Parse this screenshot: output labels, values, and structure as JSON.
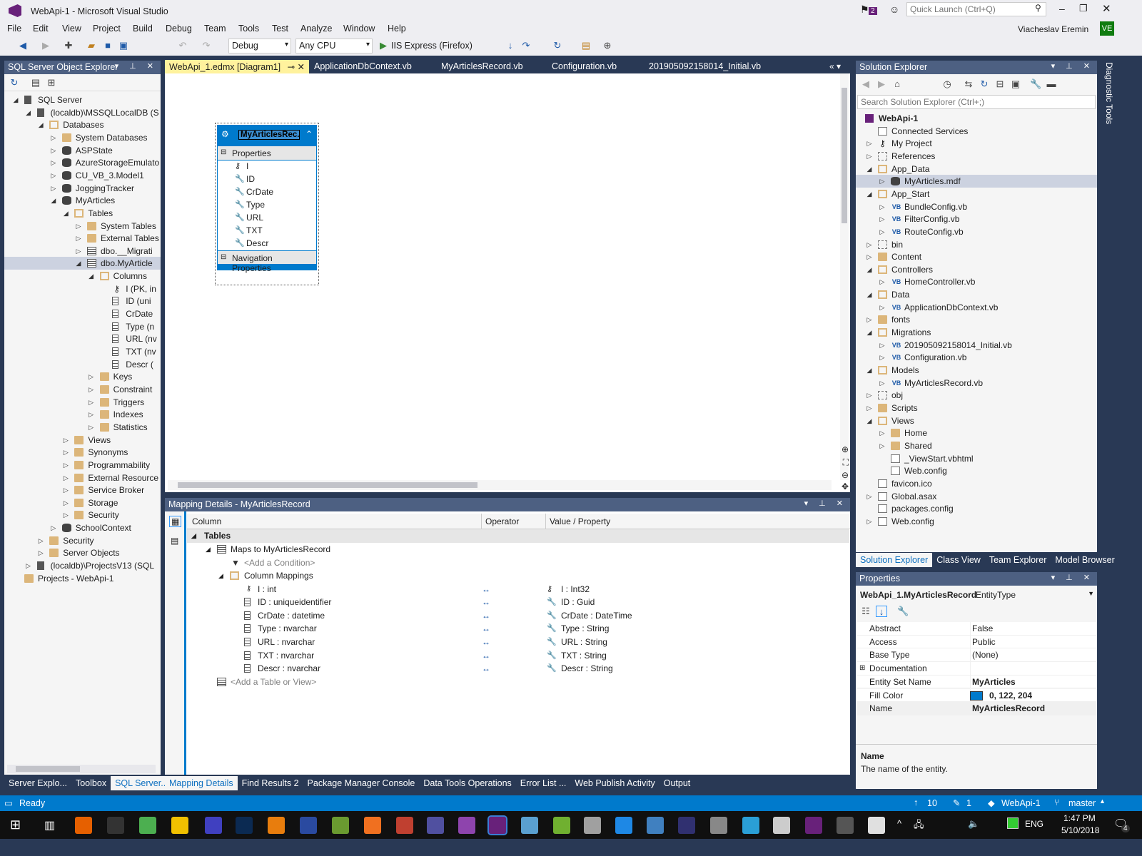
{
  "window": {
    "title": "WebApi-1 - Microsoft Visual Studio",
    "notifications": "2",
    "quick_launch_placeholder": "Quick Launch (Ctrl+Q)",
    "user": "Viacheslav Eremin",
    "user_initials": "VE"
  },
  "menu": [
    "File",
    "Edit",
    "View",
    "Project",
    "Build",
    "Debug",
    "Team",
    "Tools",
    "Test",
    "Analyze",
    "Window",
    "Help"
  ],
  "toolbar": {
    "config": "Debug",
    "platform": "Any CPU",
    "run_label": "IIS Express (Firefox)"
  },
  "sql_explorer": {
    "title": "SQL Server Object Explorer",
    "items": [
      {
        "label": "SQL Server",
        "depth": 0,
        "exp": "open",
        "icon": "server"
      },
      {
        "label": "(localdb)\\MSSQLLocalDB (S",
        "depth": 1,
        "exp": "open",
        "icon": "server"
      },
      {
        "label": "Databases",
        "depth": 2,
        "exp": "open",
        "icon": "folder-open"
      },
      {
        "label": "System Databases",
        "depth": 3,
        "exp": "closed",
        "icon": "folder"
      },
      {
        "label": "ASPState",
        "depth": 3,
        "exp": "closed",
        "icon": "db"
      },
      {
        "label": "AzureStorageEmulato",
        "depth": 3,
        "exp": "closed",
        "icon": "db"
      },
      {
        "label": "CU_VB_3.Model1",
        "depth": 3,
        "exp": "closed",
        "icon": "db"
      },
      {
        "label": "JoggingTracker",
        "depth": 3,
        "exp": "closed",
        "icon": "db"
      },
      {
        "label": "MyArticles",
        "depth": 3,
        "exp": "open",
        "icon": "db"
      },
      {
        "label": "Tables",
        "depth": 4,
        "exp": "open",
        "icon": "folder-open"
      },
      {
        "label": "System Tables",
        "depth": 5,
        "exp": "closed",
        "icon": "folder"
      },
      {
        "label": "External Tables",
        "depth": 5,
        "exp": "closed",
        "icon": "folder"
      },
      {
        "label": "dbo.__Migrati",
        "depth": 5,
        "exp": "closed",
        "icon": "table"
      },
      {
        "label": "dbo.MyArticle",
        "depth": 5,
        "exp": "open",
        "icon": "table",
        "selected": true
      },
      {
        "label": "Columns",
        "depth": 6,
        "exp": "open",
        "icon": "folder-open"
      },
      {
        "label": "I (PK, in",
        "depth": 7,
        "exp": "",
        "icon": "key"
      },
      {
        "label": "ID (uni",
        "depth": 7,
        "exp": "",
        "icon": "col"
      },
      {
        "label": "CrDate",
        "depth": 7,
        "exp": "",
        "icon": "col"
      },
      {
        "label": "Type (n",
        "depth": 7,
        "exp": "",
        "icon": "col"
      },
      {
        "label": "URL (nv",
        "depth": 7,
        "exp": "",
        "icon": "col"
      },
      {
        "label": "TXT (nv",
        "depth": 7,
        "exp": "",
        "icon": "col"
      },
      {
        "label": "Descr (",
        "depth": 7,
        "exp": "",
        "icon": "col"
      },
      {
        "label": "Keys",
        "depth": 6,
        "exp": "closed",
        "icon": "folder"
      },
      {
        "label": "Constraint",
        "depth": 6,
        "exp": "closed",
        "icon": "folder"
      },
      {
        "label": "Triggers",
        "depth": 6,
        "exp": "closed",
        "icon": "folder"
      },
      {
        "label": "Indexes",
        "depth": 6,
        "exp": "closed",
        "icon": "folder"
      },
      {
        "label": "Statistics",
        "depth": 6,
        "exp": "closed",
        "icon": "folder"
      },
      {
        "label": "Views",
        "depth": 4,
        "exp": "closed",
        "icon": "folder"
      },
      {
        "label": "Synonyms",
        "depth": 4,
        "exp": "closed",
        "icon": "folder"
      },
      {
        "label": "Programmability",
        "depth": 4,
        "exp": "closed",
        "icon": "folder"
      },
      {
        "label": "External Resource",
        "depth": 4,
        "exp": "closed",
        "icon": "folder"
      },
      {
        "label": "Service Broker",
        "depth": 4,
        "exp": "closed",
        "icon": "folder"
      },
      {
        "label": "Storage",
        "depth": 4,
        "exp": "closed",
        "icon": "folder"
      },
      {
        "label": "Security",
        "depth": 4,
        "exp": "closed",
        "icon": "folder"
      },
      {
        "label": "SchoolContext",
        "depth": 3,
        "exp": "closed",
        "icon": "db"
      },
      {
        "label": "Security",
        "depth": 2,
        "exp": "closed",
        "icon": "folder"
      },
      {
        "label": "Server Objects",
        "depth": 2,
        "exp": "closed",
        "icon": "folder"
      },
      {
        "label": "(localdb)\\ProjectsV13 (SQL",
        "depth": 1,
        "exp": "closed",
        "icon": "server"
      },
      {
        "label": "Projects - WebApi-1",
        "depth": 0,
        "exp": "",
        "icon": "folder"
      }
    ],
    "tabs": [
      "Server Explo...",
      "Toolbox",
      "SQL Server..."
    ]
  },
  "editor_tabs": [
    "WebApi_1.edmx [Diagram1]",
    "ApplicationDbContext.vb",
    "MyArticlesRecord.vb",
    "Configuration.vb",
    "201905092158014_Initial.vb"
  ],
  "entity": {
    "name": "MyArticlesRec...",
    "properties_label": "Properties",
    "properties": [
      "I",
      "ID",
      "CrDate",
      "Type",
      "URL",
      "TXT",
      "Descr"
    ],
    "nav_label": "Navigation Properties",
    "fill": "#007acc"
  },
  "mapping": {
    "title": "Mapping Details - MyArticlesRecord",
    "headers": [
      "Column",
      "Operator",
      "Value / Property"
    ],
    "tables": "Tables",
    "maps_to": "Maps to MyArticlesRecord",
    "add_condition": "<Add a Condition>",
    "column_mappings": "Column Mappings",
    "rows": [
      {
        "col": "I : int",
        "op": "↔",
        "val": "I : Int32"
      },
      {
        "col": "ID : uniqueidentifier",
        "op": "↔",
        "val": "ID : Guid"
      },
      {
        "col": "CrDate : datetime",
        "op": "↔",
        "val": "CrDate : DateTime"
      },
      {
        "col": "Type : nvarchar",
        "op": "↔",
        "val": "Type : String"
      },
      {
        "col": "URL : nvarchar",
        "op": "↔",
        "val": "URL : String"
      },
      {
        "col": "TXT : nvarchar",
        "op": "↔",
        "val": "TXT : String"
      },
      {
        "col": "Descr : nvarchar",
        "op": "↔",
        "val": "Descr : String"
      }
    ],
    "add_table": "<Add a Table or View>"
  },
  "bottom_tabs": [
    "Mapping Details",
    "Find Results 2",
    "Package Manager Console",
    "Data Tools Operations",
    "Error List ...",
    "Web Publish Activity",
    "Output"
  ],
  "solution": {
    "title": "Solution Explorer",
    "search_placeholder": "Search Solution Explorer (Ctrl+;)",
    "items": [
      {
        "label": "WebApi-1",
        "depth": 0,
        "exp": "",
        "icon": "proj",
        "bold": true
      },
      {
        "label": "Connected Services",
        "depth": 1,
        "exp": "",
        "icon": "page"
      },
      {
        "label": "My Project",
        "depth": 1,
        "exp": "closed",
        "icon": "key"
      },
      {
        "label": "References",
        "depth": 1,
        "exp": "closed",
        "icon": "plain"
      },
      {
        "label": "App_Data",
        "depth": 1,
        "exp": "open",
        "icon": "folder-open"
      },
      {
        "label": "MyArticles.mdf",
        "depth": 2,
        "exp": "closed",
        "icon": "db",
        "selected": true
      },
      {
        "label": "App_Start",
        "depth": 1,
        "exp": "open",
        "icon": "folder-open"
      },
      {
        "label": "BundleConfig.vb",
        "depth": 2,
        "exp": "closed",
        "icon": "vb"
      },
      {
        "label": "FilterConfig.vb",
        "depth": 2,
        "exp": "closed",
        "icon": "vb"
      },
      {
        "label": "RouteConfig.vb",
        "depth": 2,
        "exp": "closed",
        "icon": "vb"
      },
      {
        "label": "bin",
        "depth": 1,
        "exp": "closed",
        "icon": "plain"
      },
      {
        "label": "Content",
        "depth": 1,
        "exp": "closed",
        "icon": "folder"
      },
      {
        "label": "Controllers",
        "depth": 1,
        "exp": "open",
        "icon": "folder-open"
      },
      {
        "label": "HomeController.vb",
        "depth": 2,
        "exp": "closed",
        "icon": "vb"
      },
      {
        "label": "Data",
        "depth": 1,
        "exp": "open",
        "icon": "folder-open"
      },
      {
        "label": "ApplicationDbContext.vb",
        "depth": 2,
        "exp": "closed",
        "icon": "vb"
      },
      {
        "label": "fonts",
        "depth": 1,
        "exp": "closed",
        "icon": "folder"
      },
      {
        "label": "Migrations",
        "depth": 1,
        "exp": "open",
        "icon": "folder-open"
      },
      {
        "label": "201905092158014_Initial.vb",
        "depth": 2,
        "exp": "closed",
        "icon": "vb"
      },
      {
        "label": "Configuration.vb",
        "depth": 2,
        "exp": "closed",
        "icon": "vb"
      },
      {
        "label": "Models",
        "depth": 1,
        "exp": "open",
        "icon": "folder-open"
      },
      {
        "label": "MyArticlesRecord.vb",
        "depth": 2,
        "exp": "closed",
        "icon": "vb"
      },
      {
        "label": "obj",
        "depth": 1,
        "exp": "closed",
        "icon": "plain"
      },
      {
        "label": "Scripts",
        "depth": 1,
        "exp": "closed",
        "icon": "folder"
      },
      {
        "label": "Views",
        "depth": 1,
        "exp": "open",
        "icon": "folder-open"
      },
      {
        "label": "Home",
        "depth": 2,
        "exp": "closed",
        "icon": "folder"
      },
      {
        "label": "Shared",
        "depth": 2,
        "exp": "closed",
        "icon": "folder"
      },
      {
        "label": "_ViewStart.vbhtml",
        "depth": 2,
        "exp": "",
        "icon": "page"
      },
      {
        "label": "Web.config",
        "depth": 2,
        "exp": "",
        "icon": "page"
      },
      {
        "label": "favicon.ico",
        "depth": 1,
        "exp": "",
        "icon": "page"
      },
      {
        "label": "Global.asax",
        "depth": 1,
        "exp": "closed",
        "icon": "page"
      },
      {
        "label": "packages.config",
        "depth": 1,
        "exp": "",
        "icon": "page"
      },
      {
        "label": "Web.config",
        "depth": 1,
        "exp": "closed",
        "icon": "page"
      }
    ],
    "tabs": [
      "Solution Explorer",
      "Class View",
      "Team Explorer",
      "Model Browser"
    ]
  },
  "properties": {
    "title": "Properties",
    "object": "WebApi_1.MyArticlesRecord",
    "object_type": "EntityType",
    "rows": [
      {
        "k": "Abstract",
        "v": "False"
      },
      {
        "k": "Access",
        "v": "Public"
      },
      {
        "k": "Base Type",
        "v": "(None)"
      },
      {
        "k": "Documentation",
        "v": ""
      },
      {
        "k": "Entity Set Name",
        "v": "MyArticles",
        "bold": true
      },
      {
        "k": "Fill Color",
        "v": "0, 122, 204",
        "bold": true,
        "swatch": "#007acc"
      },
      {
        "k": "Name",
        "v": "MyArticlesRecord",
        "bold": true
      }
    ],
    "desc_title": "Name",
    "desc_text": "The name of the entity."
  },
  "diagnostic_tools": "Diagnostic Tools",
  "status": {
    "text": "Ready",
    "up": "10",
    "edits": "1",
    "repo": "WebApi-1",
    "branch": "master"
  },
  "taskbar": {
    "lang": "ENG",
    "time": "1:47 PM",
    "date": "5/10/2018",
    "notif": "4",
    "apps": [
      "#e66000",
      "#333",
      "#4caf50",
      "#f0c000",
      "#4040c0",
      "#0b2a52",
      "#e87d0d",
      "#2a4aa0",
      "#6a9a30",
      "#f07020",
      "#c04030",
      "#5050a0",
      "#8e44ad",
      "#68217a",
      "#5aa0d0",
      "#70b030",
      "#a0a0a0",
      "#1e88e5",
      "#4080c0",
      "#303070",
      "#888",
      "#2a9fd6",
      "#ccc",
      "#68217a",
      "#555",
      "#e0e0e0",
      "#b22222"
    ]
  }
}
